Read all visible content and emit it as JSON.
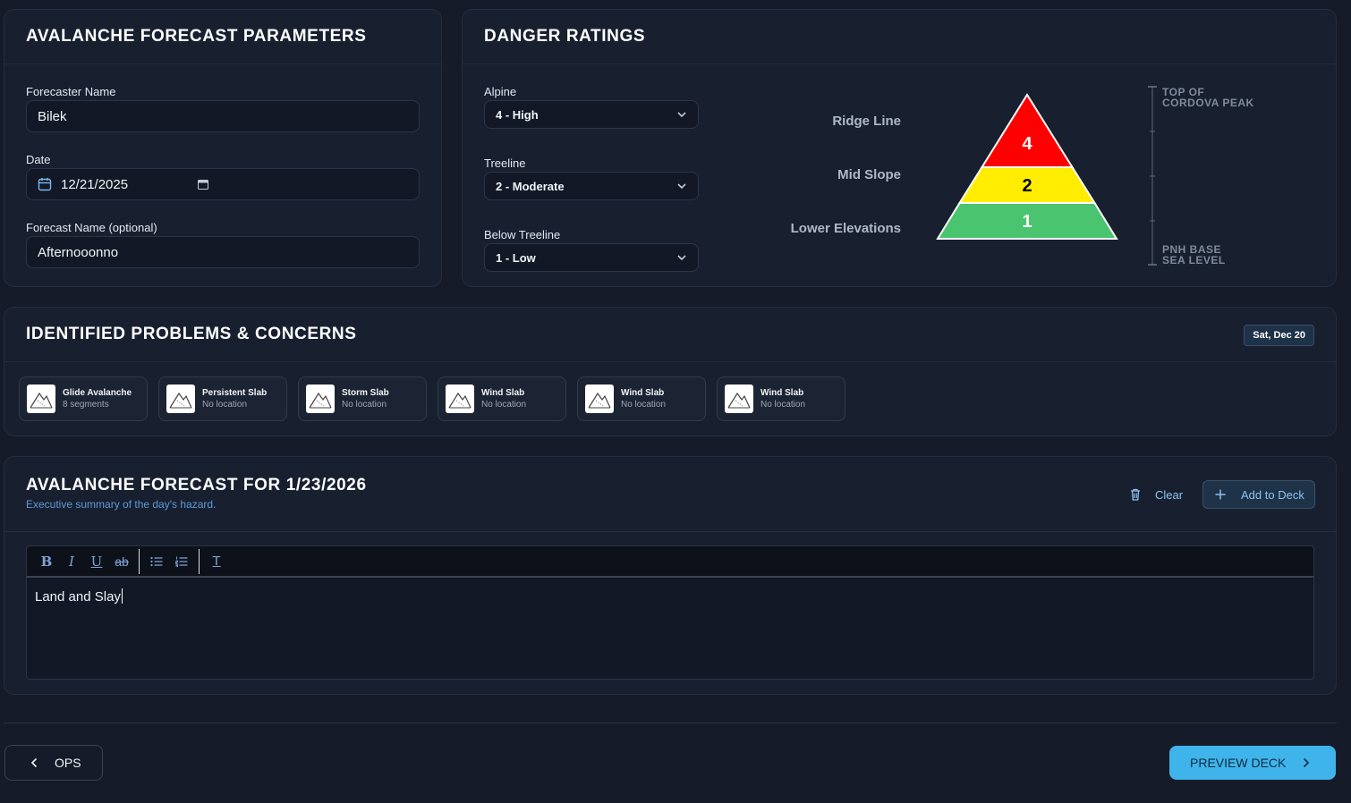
{
  "forecast_params": {
    "title": "AVALANCHE FORECAST PARAMETERS",
    "forecaster_label": "Forecaster Name",
    "forecaster_value": "Bilek",
    "date_label": "Date",
    "date_value": "12/21/2025",
    "forecast_name_label": "Forecast Name (optional)",
    "forecast_name_value": "Afternooonno"
  },
  "danger_ratings": {
    "title": "DANGER RATINGS",
    "alpine_label": "Alpine",
    "alpine_value": "4 - High",
    "treeline_label": "Treeline",
    "treeline_value": "2 - Moderate",
    "below_label": "Below Treeline",
    "below_value": "1 - Low",
    "zones": [
      {
        "label": "Ridge Line",
        "rating": "4",
        "color": "#ff0000",
        "text_color": "#ffffff"
      },
      {
        "label": "Mid Slope",
        "rating": "2",
        "color": "#ffed00",
        "text_color": "#000000"
      },
      {
        "label": "Lower Elevations",
        "rating": "1",
        "color": "#4ac46e",
        "text_color": "#ffffff"
      }
    ],
    "scale_top_line1": "TOP OF",
    "scale_top_line2": "CORDOVA PEAK",
    "scale_bottom_line1": "PNH BASE",
    "scale_bottom_line2": "SEA LEVEL"
  },
  "problems": {
    "title": "IDENTIFIED PROBLEMS & CONCERNS",
    "date_badge": "Sat, Dec 20",
    "items": [
      {
        "name": "Glide Avalanche",
        "sub": "8 segments"
      },
      {
        "name": "Persistent Slab",
        "sub": "No location"
      },
      {
        "name": "Storm Slab",
        "sub": "No location"
      },
      {
        "name": "Wind Slab",
        "sub": "No location"
      },
      {
        "name": "Wind Slab",
        "sub": "No location"
      },
      {
        "name": "Wind Slab",
        "sub": "No location"
      }
    ]
  },
  "summary": {
    "title": "AVALANCHE FORECAST FOR 1/23/2026",
    "subtitle": "Executive summary of the day's hazard.",
    "clear_label": "Clear",
    "add_label": "Add to Deck",
    "editor_text": "Land and Slay",
    "toolbar": {
      "bold": "B",
      "italic": "I",
      "underline": "U",
      "strike": "ab",
      "clear_format": "T"
    }
  },
  "footer": {
    "back_label": "OPS",
    "next_label": "PREVIEW DECK"
  },
  "colors": {
    "accent": "#3fb4ea",
    "background": "#151b28",
    "card": "#182030",
    "link": "#7ab8ef"
  }
}
